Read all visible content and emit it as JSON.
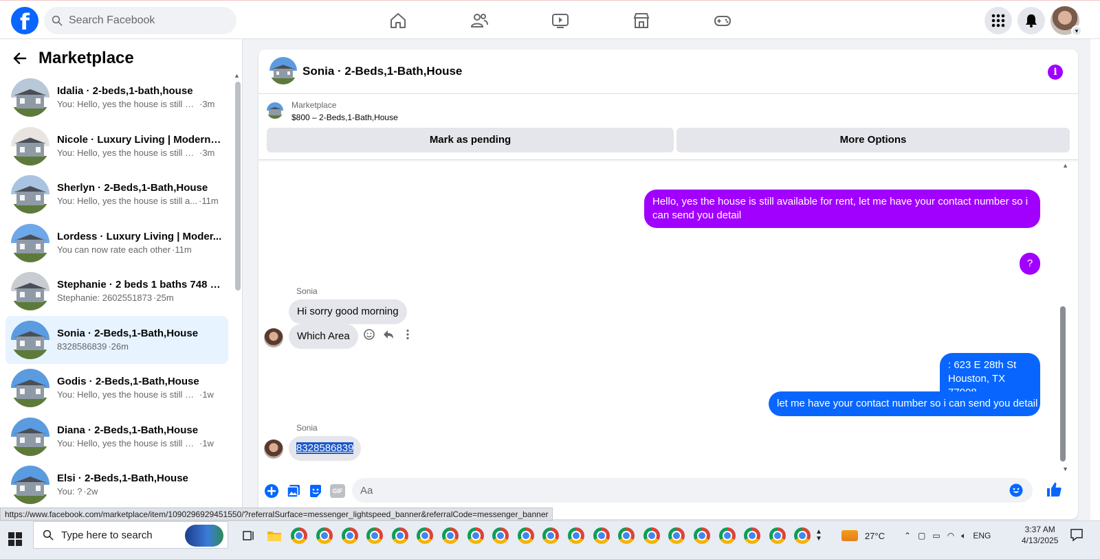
{
  "topbar": {
    "logo": "f",
    "search_placeholder": "Search Facebook",
    "nav_icons": [
      "home-icon",
      "friends-icon",
      "watch-icon",
      "marketplace-icon",
      "gaming-icon"
    ],
    "right_icons": [
      "menu-grid-icon",
      "bell-icon",
      "profile-avatar"
    ],
    "accent": "#0866ff"
  },
  "sidebar": {
    "title": "Marketplace",
    "conversations": [
      {
        "name": "Idalia · 2-beds,1-bath,house",
        "snippet": "You: Hello, yes the house is still av...",
        "time": "·3m",
        "sky": "#b9c8d8"
      },
      {
        "name": "Nicole · Luxury Living | Modern ...",
        "snippet": "You: Hello, yes the house is still av...",
        "time": "·3m",
        "sky": "#e8e4df"
      },
      {
        "name": "Sherlyn · 2-Beds,1-Bath,House",
        "snippet": "You: Hello, yes the house is still a...",
        "time": "·11m",
        "sky": "#a9c4e0"
      },
      {
        "name": "Lordess · Luxury Living | Moder...",
        "snippet": "You can now rate each other",
        "time": "·11m",
        "sky": "#6fa8e8"
      },
      {
        "name": "Stephanie · 2 beds 1 baths 748 s...",
        "snippet": "Stephanie: 2602551873",
        "time": "·25m",
        "sky": "#c9cdd2"
      },
      {
        "name": "Sonia · 2-Beds,1-Bath,House",
        "snippet": "8328586839",
        "time": "·26m",
        "sky": "#5b9be0",
        "active": true
      },
      {
        "name": "Godis · 2-Beds,1-Bath,House",
        "snippet": "You: Hello, yes the house is still ava...",
        "time": "·1w",
        "sky": "#5b9be0"
      },
      {
        "name": "Diana · 2-Beds,1-Bath,House",
        "snippet": "You: Hello, yes the house is still ava...",
        "time": "·1w",
        "sky": "#5b9be0"
      },
      {
        "name": "Elsi · 2-Beds,1-Bath,House",
        "snippet": "You: ?",
        "time": "·2w",
        "sky": "#5b9be0"
      }
    ]
  },
  "chat": {
    "title": "Sonia · 2-Beds,1-Bath,House",
    "listing_label": "Marketplace",
    "listing_price": "$800 – 2-Beds,1-Bath,House",
    "btn_pending": "Mark as pending",
    "btn_more": "More Options",
    "messages": {
      "m1": "Hello, yes the house is still available for rent, let me have your contact number so i can send you detail",
      "m2": "?",
      "sender1": "Sonia",
      "m3": "Hi sorry good morning",
      "m4": "Which Area",
      "m5_line1": ": 623 E 28th St",
      "m5_line2": "Houston, TX 77008",
      "m6": "let me have your contact number so i can send you detail",
      "sender2": "Sonia",
      "m7": "8328586839"
    },
    "composer_placeholder": "Aa",
    "colors": {
      "outgoing_purple": "#a100ff",
      "outgoing_blue": "#0866ff",
      "incoming": "#e4e6eb"
    }
  },
  "status_url": "https://www.facebook.com/marketplace/item/1090296929451550/?referralSurface=messenger_lightspeed_banner&referralCode=messenger_banner",
  "taskbar": {
    "search_placeholder": "Type here to search",
    "app_count": 21,
    "temperature": "27°C",
    "language": "ENG",
    "time": "3:37 AM",
    "date": "4/13/2025"
  }
}
